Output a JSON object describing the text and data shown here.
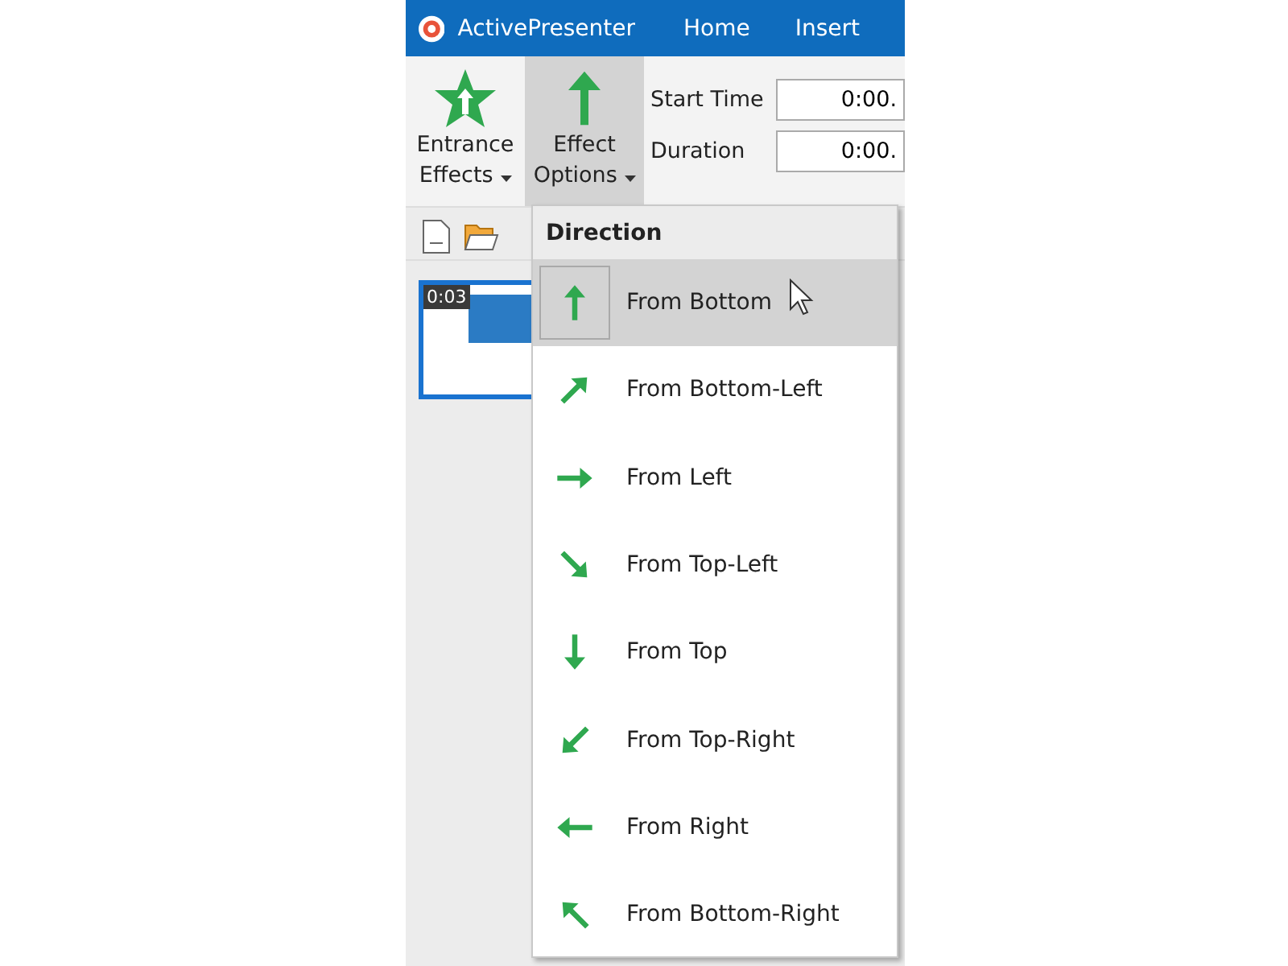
{
  "title_bar": {
    "app_name": "ActivePresenter",
    "tabs": [
      {
        "label": "Home"
      },
      {
        "label": "Insert"
      }
    ]
  },
  "ribbon": {
    "buttons": [
      {
        "kind": "star",
        "label_lines": [
          "Entrance",
          "Effects"
        ],
        "expanded": false
      },
      {
        "kind": "arrow",
        "label_lines": [
          "Effect",
          "Options"
        ],
        "expanded": true
      }
    ],
    "fields": [
      {
        "label": "Start Time",
        "value": "0:00."
      },
      {
        "label": "Duration",
        "value": "0:00."
      }
    ]
  },
  "slides": [
    {
      "duration": "0:03",
      "selected": true
    }
  ],
  "menu": {
    "header": "Direction",
    "items": [
      {
        "label": "From Bottom",
        "kind": "up",
        "selected": true
      },
      {
        "label": "From Bottom-Left",
        "kind": "up-right",
        "selected": false
      },
      {
        "label": "From Left",
        "kind": "right",
        "selected": false
      },
      {
        "label": "From Top-Left",
        "kind": "down-right",
        "selected": false
      },
      {
        "label": "From Top",
        "kind": "down",
        "selected": false
      },
      {
        "label": "From Top-Right",
        "kind": "down-left",
        "selected": false
      },
      {
        "label": "From Right",
        "kind": "left",
        "selected": false
      },
      {
        "label": "From Bottom-Right",
        "kind": "up-left",
        "selected": false
      }
    ]
  }
}
